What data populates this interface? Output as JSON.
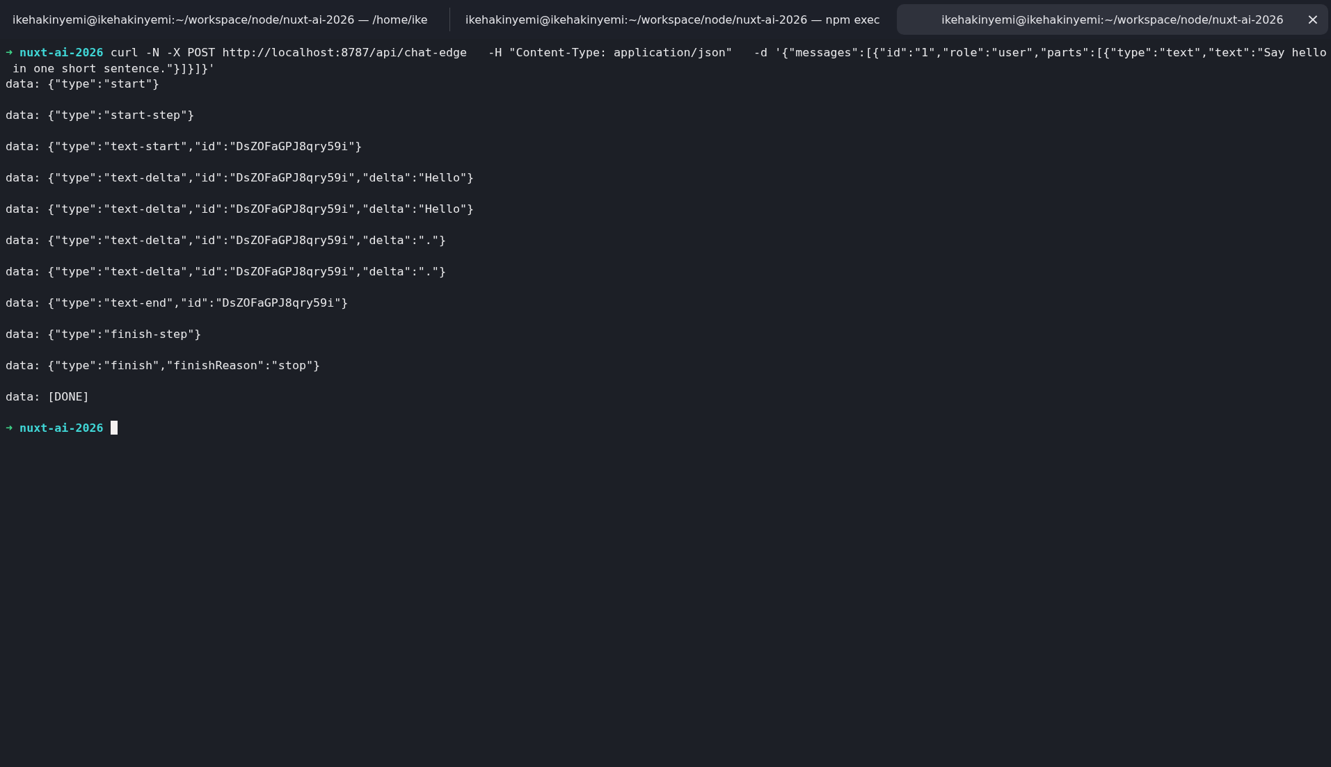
{
  "tabs": [
    {
      "label": "ikehakinyemi@ikehakinyemi:~/workspace/node/nuxt-ai-2026 — /home/ike",
      "selected": false
    },
    {
      "label": "ikehakinyemi@ikehakinyemi:~/workspace/node/nuxt-ai-2026 — npm exec",
      "selected": false
    },
    {
      "label": "ikehakinyemi@ikehakinyemi:~/workspace/node/nuxt-ai-2026",
      "selected": true,
      "close": "×"
    }
  ],
  "terminal": {
    "prompt_arrow": "➜",
    "directory": "nuxt-ai-2026",
    "command": "curl -N -X POST http://localhost:8787/api/chat-edge   -H \"Content-Type: application/json\"   -d '{\"messages\":[{\"id\":\"1\",\"role\":\"user\",\"parts\":[{\"type\":\"text\",\"text\":\"Say hello",
    "command_continued": " in one short sentence.\"}]}]}'",
    "output": [
      "data: {\"type\":\"start\"}",
      "data: {\"type\":\"start-step\"}",
      "data: {\"type\":\"text-start\",\"id\":\"DsZOFaGPJ8qry59i\"}",
      "data: {\"type\":\"text-delta\",\"id\":\"DsZOFaGPJ8qry59i\",\"delta\":\"Hello\"}",
      "data: {\"type\":\"text-delta\",\"id\":\"DsZOFaGPJ8qry59i\",\"delta\":\"Hello\"}",
      "data: {\"type\":\"text-delta\",\"id\":\"DsZOFaGPJ8qry59i\",\"delta\":\".\"}",
      "data: {\"type\":\"text-delta\",\"id\":\"DsZOFaGPJ8qry59i\",\"delta\":\".\"}",
      "data: {\"type\":\"text-end\",\"id\":\"DsZOFaGPJ8qry59i\"}",
      "data: {\"type\":\"finish-step\"}",
      "data: {\"type\":\"finish\",\"finishReason\":\"stop\"}",
      "data: [DONE]"
    ],
    "final_prompt": {
      "prompt_arrow": "➜",
      "directory": "nuxt-ai-2026"
    }
  }
}
